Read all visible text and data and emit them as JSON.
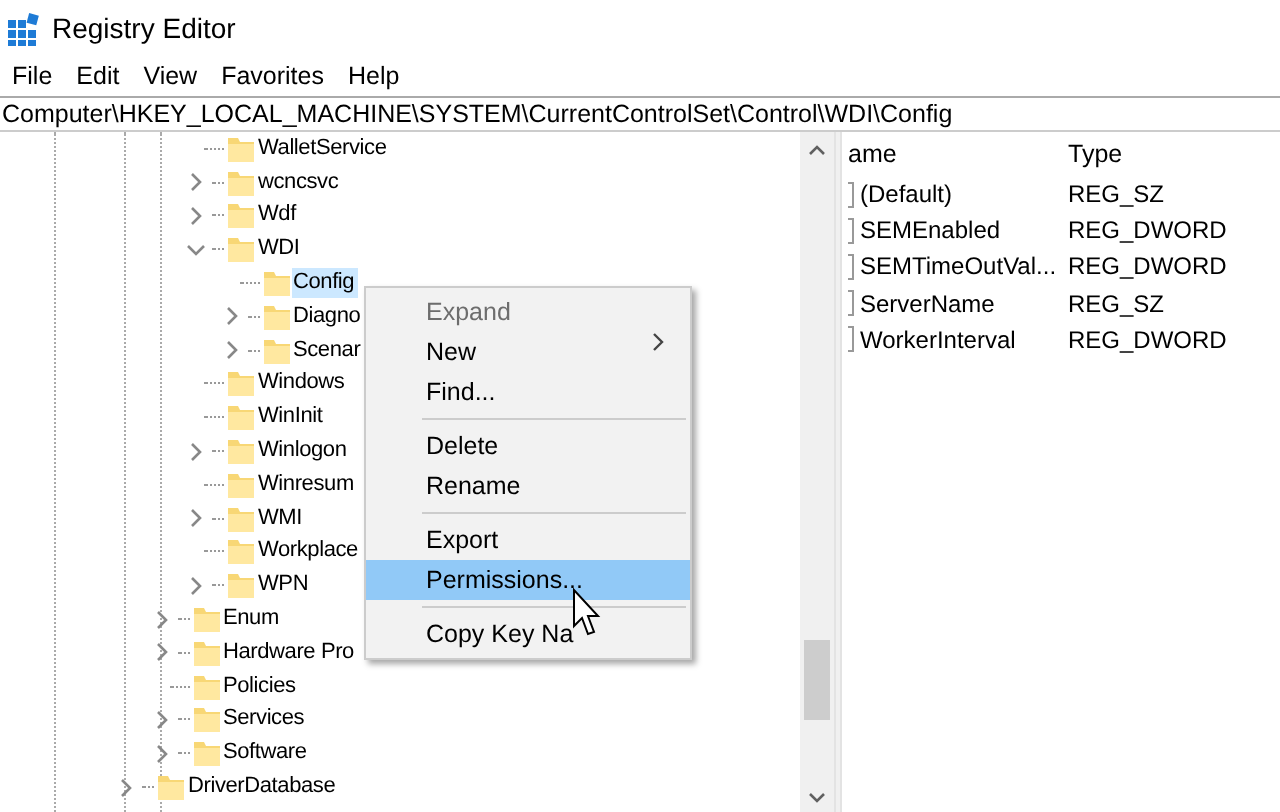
{
  "window": {
    "title": "Registry Editor"
  },
  "menu": [
    "File",
    "Edit",
    "View",
    "Favorites",
    "Help"
  ],
  "address": "Computer\\HKEY_LOCAL_MACHINE\\SYSTEM\\CurrentControlSet\\Control\\WDI\\Config",
  "tree": [
    {
      "children": [
        {
          "children": [
            {
              "label": "WalletService",
              "kind": "leaf",
              "selected": false
            },
            {
              "label": "wcncsvc",
              "kind": "branch",
              "expanded": false,
              "selected": false
            },
            {
              "label": "Wdf",
              "kind": "branch",
              "expanded": false,
              "selected": false
            },
            {
              "label": "WDI",
              "kind": "branch",
              "expanded": true,
              "selected": false,
              "children": [
                {
                  "label": "Config",
                  "kind": "leaf",
                  "selected": true
                },
                {
                  "label": "Diagno",
                  "kind": "branch",
                  "expanded": false,
                  "selected": false
                },
                {
                  "label": "Scenar",
                  "kind": "branch",
                  "expanded": false,
                  "selected": false
                }
              ]
            },
            {
              "label": "Windows",
              "kind": "leaf",
              "selected": false
            },
            {
              "label": "WinInit",
              "kind": "leaf",
              "selected": false
            },
            {
              "label": "Winlogon",
              "kind": "branch",
              "expanded": false,
              "selected": false
            },
            {
              "label": "Winresum",
              "kind": "leaf",
              "selected": false
            },
            {
              "label": "WMI",
              "kind": "branch",
              "expanded": false,
              "selected": false
            },
            {
              "label": "Workplace",
              "kind": "leaf",
              "selected": false
            },
            {
              "label": "WPN",
              "kind": "branch",
              "expanded": false,
              "selected": false
            }
          ]
        },
        {
          "label": "Enum",
          "kind": "branch",
          "expanded": false,
          "selected": false
        },
        {
          "label": "Hardware Pro",
          "kind": "branch",
          "expanded": false,
          "selected": false
        },
        {
          "label": "Policies",
          "kind": "leaf",
          "selected": false
        },
        {
          "label": "Services",
          "kind": "branch",
          "expanded": false,
          "selected": false
        },
        {
          "label": "Software",
          "kind": "branch",
          "expanded": false,
          "selected": false
        }
      ]
    },
    {
      "label": "DriverDatabase",
      "kind": "branch",
      "expanded": false,
      "selected": false
    }
  ],
  "values": {
    "columns": [
      "ame",
      "Type"
    ],
    "rows": [
      {
        "name": "(Default)",
        "type": "REG_SZ"
      },
      {
        "name": "SEMEnabled",
        "type": "REG_DWORD"
      },
      {
        "name": "SEMTimeOutVal...",
        "type": "REG_DWORD"
      },
      {
        "name": "ServerName",
        "type": "REG_SZ"
      },
      {
        "name": "WorkerInterval",
        "type": "REG_DWORD"
      }
    ]
  },
  "context_menu": [
    {
      "kind": "item",
      "label": "Expand",
      "disabled": true,
      "selected": false,
      "submenu": false
    },
    {
      "kind": "item",
      "label": "New",
      "disabled": false,
      "selected": false,
      "submenu": true
    },
    {
      "kind": "item",
      "label": "Find...",
      "disabled": false,
      "selected": false,
      "submenu": false
    },
    {
      "kind": "separator"
    },
    {
      "kind": "item",
      "label": "Delete",
      "disabled": false,
      "selected": false,
      "submenu": false
    },
    {
      "kind": "item",
      "label": "Rename",
      "disabled": false,
      "selected": false,
      "submenu": false
    },
    {
      "kind": "separator"
    },
    {
      "kind": "item",
      "label": "Export",
      "disabled": false,
      "selected": false,
      "submenu": false
    },
    {
      "kind": "item",
      "label": "Permissions...",
      "disabled": false,
      "selected": true,
      "submenu": false
    },
    {
      "kind": "separator"
    },
    {
      "kind": "item",
      "label": "Copy Key Na",
      "disabled": false,
      "selected": false,
      "submenu": false
    }
  ]
}
